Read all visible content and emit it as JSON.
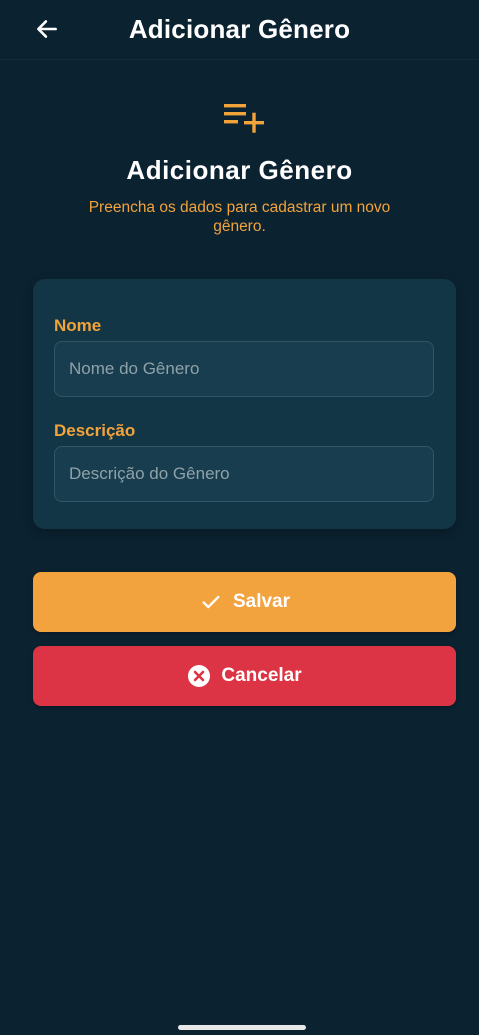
{
  "appbar": {
    "title": "Adicionar Gênero",
    "back_icon": "arrow-left-icon"
  },
  "hero": {
    "icon": "playlist-add-icon",
    "title": "Adicionar Gênero",
    "subtitle": "Preencha os dados para cadastrar um novo gênero."
  },
  "form": {
    "name": {
      "label": "Nome",
      "placeholder": "Nome do Gênero",
      "value": ""
    },
    "description": {
      "label": "Descrição",
      "placeholder": "Descrição do Gênero",
      "value": ""
    }
  },
  "actions": {
    "save_label": "Salvar",
    "save_icon": "check-icon",
    "cancel_label": "Cancelar",
    "cancel_icon": "close-circle-icon"
  },
  "colors": {
    "background": "#0b2231",
    "card": "#133646",
    "accent": "#f2a33e",
    "danger": "#dc3444"
  }
}
